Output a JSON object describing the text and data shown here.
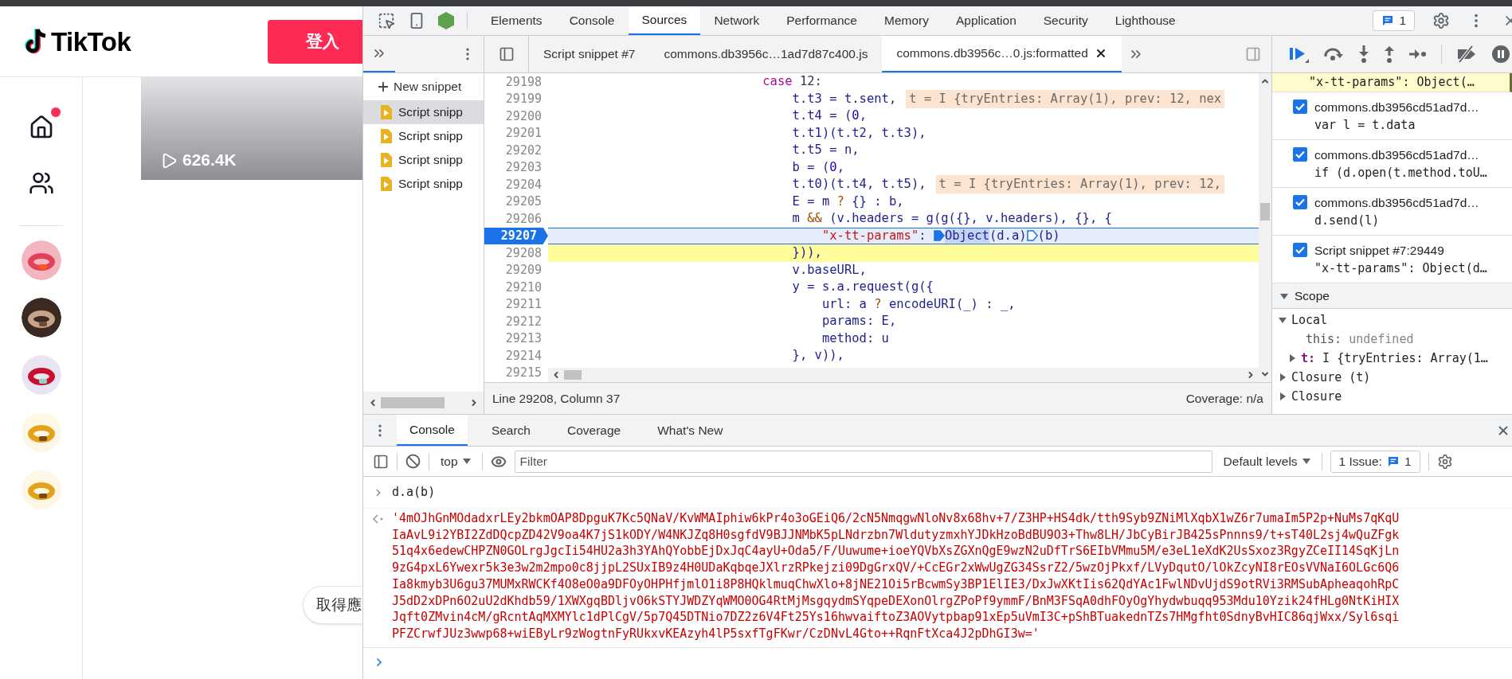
{
  "tiktok": {
    "logo_text": "TikTok",
    "login_button": "登入",
    "nav": [
      {
        "kind": "home",
        "notification": true
      },
      {
        "kind": "following",
        "notification": false
      }
    ],
    "video": {
      "views": "626.4K"
    },
    "get_app_button": "取得應"
  },
  "devtools": {
    "tabs": [
      {
        "label": "Elements",
        "selected": false
      },
      {
        "label": "Console",
        "selected": false
      },
      {
        "label": "Sources",
        "selected": true
      },
      {
        "label": "Network",
        "selected": false
      },
      {
        "label": "Performance",
        "selected": false
      },
      {
        "label": "Memory",
        "selected": false
      },
      {
        "label": "Application",
        "selected": false
      },
      {
        "label": "Security",
        "selected": false
      },
      {
        "label": "Lighthouse",
        "selected": false
      }
    ],
    "issues_count": "1",
    "navigator": {
      "new_snippet": "New snippet",
      "snippets": [
        {
          "label": "Script snipp",
          "selected": true
        },
        {
          "label": "Script snipp",
          "selected": false
        },
        {
          "label": "Script snipp",
          "selected": false
        },
        {
          "label": "Script snipp",
          "selected": false
        }
      ]
    },
    "editor": {
      "tabs": [
        {
          "label": "Script snippet #7",
          "selected": false,
          "closable": false
        },
        {
          "label": "commons.db3956c…1ad7d87c400.js",
          "selected": false,
          "closable": false
        },
        {
          "label": "commons.db3956c…0.js:formatted",
          "selected": true,
          "closable": true
        }
      ],
      "lines": [
        {
          "n": "29198",
          "breakpoint": false,
          "paused": false,
          "parts": [
            {
              "kind": "keyword",
              "t": "                            case"
            },
            {
              "kind": "plain",
              "t": " 12:"
            }
          ]
        },
        {
          "n": "29199",
          "breakpoint": false,
          "paused": false,
          "parts": [
            {
              "kind": "name",
              "t": "                                t.t3 = t.sent,"
            }
          ],
          "inline_value": "t = I {tryEntries: Array(1), prev: 12, nex"
        },
        {
          "n": "29200",
          "breakpoint": false,
          "paused": false,
          "parts": [
            {
              "kind": "name",
              "t": "                                t.t4 = ("
            },
            {
              "kind": "number",
              "t": "0"
            },
            {
              "kind": "name",
              "t": ","
            }
          ]
        },
        {
          "n": "29201",
          "breakpoint": false,
          "paused": false,
          "parts": [
            {
              "kind": "name",
              "t": "                                t.t1)(t.t2, t.t3),"
            }
          ]
        },
        {
          "n": "29202",
          "breakpoint": false,
          "paused": false,
          "parts": [
            {
              "kind": "name",
              "t": "                                t.t5 = n,"
            }
          ]
        },
        {
          "n": "29203",
          "breakpoint": false,
          "paused": false,
          "parts": [
            {
              "kind": "name",
              "t": "                                b = ("
            },
            {
              "kind": "number",
              "t": "0"
            },
            {
              "kind": "name",
              "t": ","
            }
          ]
        },
        {
          "n": "29204",
          "breakpoint": false,
          "paused": false,
          "parts": [
            {
              "kind": "name",
              "t": "                                t.t0)(t.t4, t.t5),"
            }
          ],
          "inline_value": "t = I {tryEntries: Array(1), prev: 12,"
        },
        {
          "n": "29205",
          "breakpoint": false,
          "paused": false,
          "parts": [
            {
              "kind": "name",
              "t": "                                E = m "
            },
            {
              "kind": "operator",
              "t": "?"
            },
            {
              "kind": "name",
              "t": " {} : b,"
            }
          ]
        },
        {
          "n": "29206",
          "breakpoint": false,
          "paused": false,
          "parts": [
            {
              "kind": "name",
              "t": "                                m "
            },
            {
              "kind": "operator",
              "t": "&&"
            },
            {
              "kind": "name",
              "t": " (v.headers = g(g({}, v.headers), {}, {"
            }
          ]
        },
        {
          "n": "29207",
          "breakpoint": true,
          "paused": false,
          "parts": [
            {
              "kind": "string",
              "t": "                                    \"x-tt-params\""
            },
            {
              "kind": "plain",
              "t": ": "
            },
            {
              "kind": "marker",
              "active": true
            },
            {
              "kind": "selection",
              "t": "Object"
            },
            {
              "kind": "name",
              "t": "(d.a)"
            },
            {
              "kind": "marker",
              "active": false
            },
            {
              "kind": "name",
              "t": "(b)"
            }
          ]
        },
        {
          "n": "29208",
          "breakpoint": false,
          "paused": true,
          "parts": [
            {
              "kind": "name",
              "t": "                                })),"
            }
          ]
        },
        {
          "n": "29209",
          "breakpoint": false,
          "paused": false,
          "parts": [
            {
              "kind": "name",
              "t": "                                v.baseURL,"
            }
          ]
        },
        {
          "n": "29210",
          "breakpoint": false,
          "paused": false,
          "parts": [
            {
              "kind": "name",
              "t": "                                y = s.a.request(g({"
            }
          ]
        },
        {
          "n": "29211",
          "breakpoint": false,
          "paused": false,
          "parts": [
            {
              "kind": "name",
              "t": "                                    url: a "
            },
            {
              "kind": "operator",
              "t": "?"
            },
            {
              "kind": "name",
              "t": " encodeURI(_) : _,"
            }
          ]
        },
        {
          "n": "29212",
          "breakpoint": false,
          "paused": false,
          "parts": [
            {
              "kind": "name",
              "t": "                                    params: E,"
            }
          ]
        },
        {
          "n": "29213",
          "breakpoint": false,
          "paused": false,
          "parts": [
            {
              "kind": "name",
              "t": "                                    method: u"
            }
          ]
        },
        {
          "n": "29214",
          "breakpoint": false,
          "paused": false,
          "parts": [
            {
              "kind": "name",
              "t": "                                }, v)),"
            }
          ]
        },
        {
          "n": "29215",
          "breakpoint": false,
          "paused": false
        }
      ],
      "status": "Line 29208, Column 37",
      "coverage": "Coverage: n/a"
    },
    "debugger": {
      "paused_breakpoint_code": "\"x-tt-params\": Object(…",
      "breakpoints": [
        {
          "file": "commons.db3956cd51ad7d…",
          "code": "var l = t.data",
          "checked": true
        },
        {
          "file": "commons.db3956cd51ad7d…",
          "code": "if (d.open(t.method.toU…",
          "checked": true
        },
        {
          "file": "commons.db3956cd51ad7d…",
          "code": "d.send(l)",
          "checked": true
        },
        {
          "file": "Script snippet #7:29449",
          "code": "\"x-tt-params\": Object(d…",
          "checked": true
        }
      ],
      "scope": {
        "title": "Scope",
        "expanded": true,
        "items": [
          {
            "label": "Local",
            "expanded": true,
            "children": [
              {
                "name": "this:",
                "value": "undefined",
                "kind": "primitive"
              },
              {
                "name": "t:",
                "value": "I {tryEntries: Array(1…",
                "kind": "object",
                "expanded": false
              }
            ]
          },
          {
            "label": "Closure (t)",
            "expanded": false
          },
          {
            "label": "Closure",
            "expanded": false
          }
        ]
      }
    },
    "drawer": {
      "tabs": [
        {
          "label": "Console",
          "selected": true
        },
        {
          "label": "Search",
          "selected": false
        },
        {
          "label": "Coverage",
          "selected": false
        },
        {
          "label": "What's New",
          "selected": false
        }
      ],
      "context": "top",
      "filter_placeholder": "Filter",
      "levels": "Default levels",
      "issues_label": "1 Issue:",
      "issues_count": "1",
      "input": "d.a(b)",
      "result_lines": [
        "'4mOJhGnMOdadxrLEy2bkmOAP8DpguK7Kc5QNaV/KvWMAIphiw6kPr4o3oGEiQ6/2cN5NmqgwNloNv8x68hv+7/Z3HP+HS4dk/tth9Syb9ZNiMlXqbX1wZ6r7umaIm5P2p+NuMs7qKqU",
        "IaAvL9i2YBI2ZdDQcpZD42V9oa4K7jS1kODY/W4NKJZq8H0sgfdV9BJJNMbK5pLNdrzbn7WldutyzmxhYJDkHzoBdBU9O3+Thw8LH/JbCyBirJB425sPnnns9/t+sT40L2sj4wQuZFgk",
        "51q4x6edewCHPZN0GOLrgJgcIi54HU2a3h3YAhQYobbEjDxJqC4ayU+Oda5/F/Uuwume+ioeYQVbXsZGXnQgE9wzN2uDfTrS6EIbVMmu5M/e3eL1eXdK2UsSxoz3RgyZCeII14SqKjLn",
        "9zG4pxL6Ywexr5k3e3w2m2mpo0c8jjpL2SUxIB9z4H0UDaKqbqeJXlrzRPkejzi09DgGrxQV/+CcEGr2xWwUgZG34SsrZ2/5wzOjPkxf/LVyDqutO/lOkZcyNI8rEOsVVNaI6OLGc6Q6",
        "Ia8kmyb3U6gu37MUMxRWCKf4O8eO0a9DFOyOHPHfjmlO1i8P8HQklmuqChwXlo+8jNE21Oi5rBcwmSy3BP1ElIE3/DxJwXKtIis62QdYAc1FwlNDvUjdS9otRVi3RMSubApheaqohRpC",
        "J5dD2xDPn6O2uU2dKhdb59/1XWXgqBDljvO6kSTYJWDZYqWMO0OG4RtMjMsgqydmSYqpeDEXonOlrgZPoPf9ymmF/BnM3FSqA0dhFOyOgYhydwbuqq953Mdu10Yzik24fHLg0NtKiHIX",
        "Jqft0ZMvin4cM/gRcntAqMXMYlc1dPlCgV/5p7Q45DTNio7DZ2z6V4Ft25Ys16hwvaiftoZ3AOVytpbap91xEp5uVmI3C+pShBTuakednTZs7HMgfht0SdnyBvHIC86qjWxx/Syl6sqi",
        "PFZCrwfJUz3wwp68+wiEByLr9zWogtnFyRUkxvKEAzyh4lP5sxfTgFKwr/CzDNvL4Gto++RqnFtXca4J2pDhGI3w='"
      ]
    }
  }
}
